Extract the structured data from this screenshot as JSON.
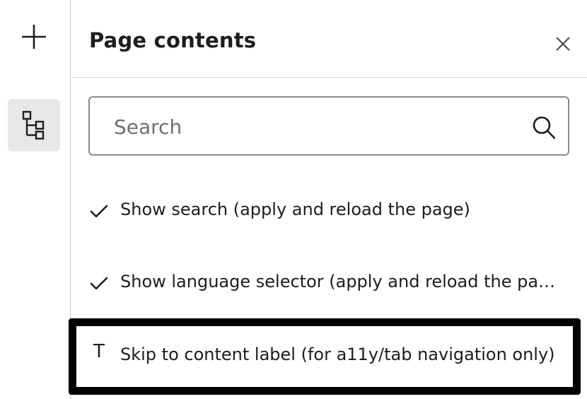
{
  "rail": {
    "add_icon": "plus-icon",
    "tree_icon": "tree-structure-icon"
  },
  "panel": {
    "title": "Page contents",
    "close_icon": "close-icon"
  },
  "search": {
    "placeholder": "Search",
    "value": "",
    "icon": "search-icon"
  },
  "items": [
    {
      "icon": "check-icon",
      "label": "Show search (apply and reload the page)"
    },
    {
      "icon": "check-icon",
      "label": "Show language selector (apply and reload the page)"
    },
    {
      "icon": "text-icon",
      "icon_glyph": "T",
      "label": "Skip to content label (for a11y/tab navigation only)"
    }
  ]
}
